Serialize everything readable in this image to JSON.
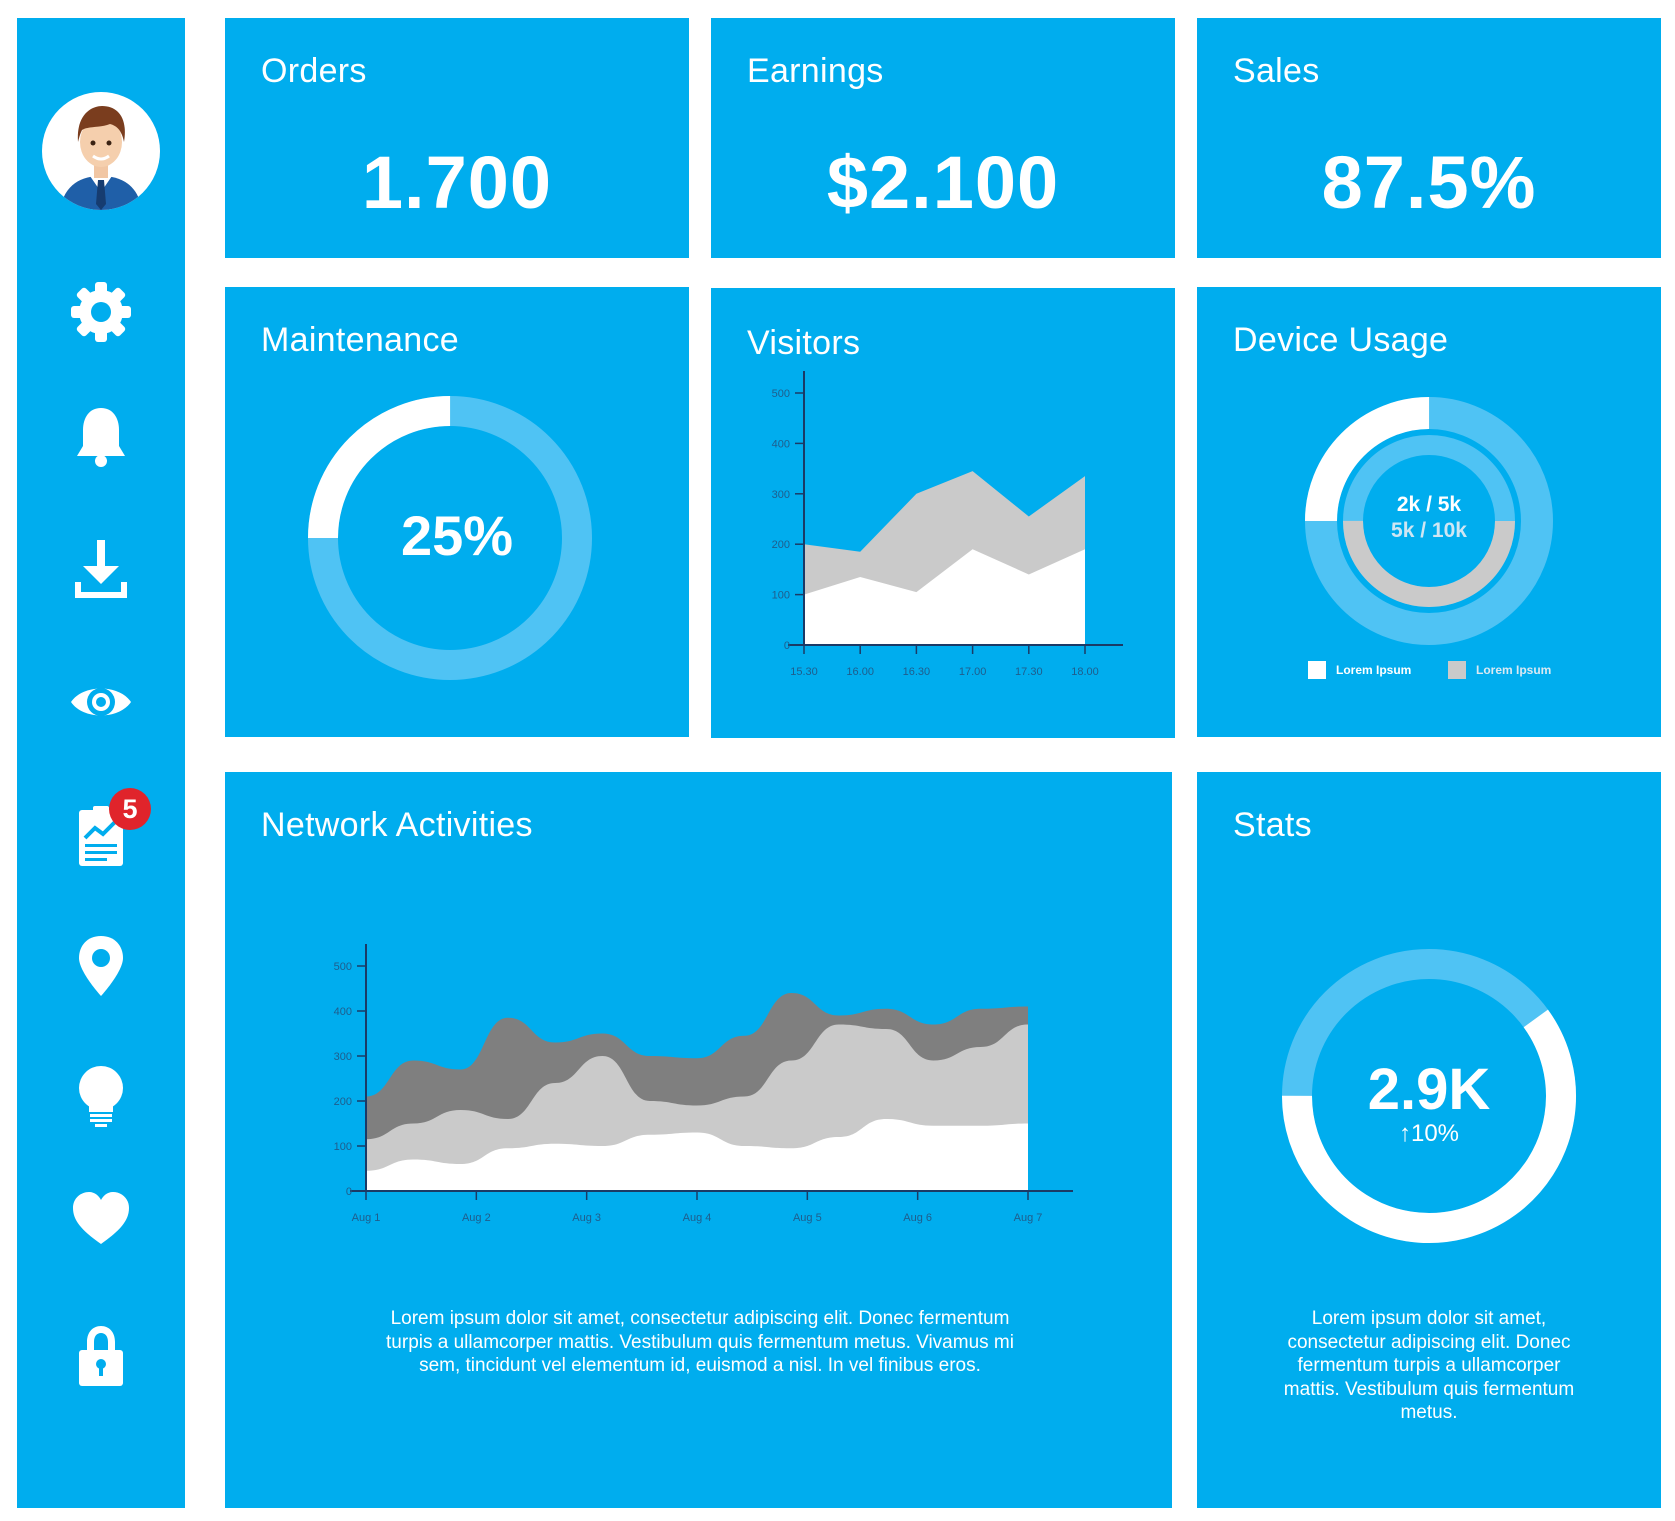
{
  "colors": {
    "panel": "#00adee",
    "ring_light": "#4fc3f4",
    "white": "#ffffff",
    "gray_light": "#cacaca",
    "gray_dark": "#7f7f7f",
    "axis": "#1b3a66",
    "badge": "#e0242b"
  },
  "sidebar": {
    "icons": [
      "gear-icon",
      "bell-icon",
      "download-icon",
      "eye-icon",
      "report-icon",
      "location-pin-icon",
      "lightbulb-icon",
      "heart-icon",
      "lock-icon"
    ],
    "badge_count": "5"
  },
  "orders": {
    "title": "Orders",
    "value": "1.700"
  },
  "earnings": {
    "title": "Earnings",
    "value": "$2.100"
  },
  "sales": {
    "title": "Sales",
    "value": "87.5%"
  },
  "maintenance": {
    "title": "Maintenance",
    "value": "25%",
    "fraction": 0.25
  },
  "visitors": {
    "title": "Visitors",
    "chart_data": {
      "type": "area",
      "x": [
        "15.30",
        "16.00",
        "16.30",
        "17.00",
        "17.30",
        "18.00"
      ],
      "series": [
        {
          "color": "#cacaca",
          "values": [
            200,
            185,
            300,
            345,
            255,
            335
          ]
        },
        {
          "color": "#ffffff",
          "values": [
            100,
            135,
            105,
            190,
            140,
            190
          ]
        }
      ],
      "y_ticks": [
        "0",
        "100",
        "200",
        "300",
        "400",
        "500"
      ],
      "ylim": [
        0,
        500
      ]
    }
  },
  "device_usage": {
    "title": "Device Usage",
    "outer_fraction": 0.25,
    "inner_fraction": 0.5,
    "line1": "2k / 5k",
    "line2": "5k / 10k",
    "legend": [
      {
        "label": "Lorem Ipsum",
        "color": "#ffffff"
      },
      {
        "label": "Lorem Ipsum",
        "color": "#cacaca"
      }
    ]
  },
  "network": {
    "title": "Network Activities",
    "chart_data": {
      "type": "area",
      "x": [
        "Aug 1",
        "Aug 2",
        "Aug 3",
        "Aug 4",
        "Aug 5",
        "Aug 6",
        "Aug 7"
      ],
      "y_ticks": [
        "0",
        "100",
        "200",
        "300",
        "400",
        "500"
      ],
      "ylim": [
        0,
        500
      ],
      "series": [
        {
          "color": "#7f7f7f",
          "values": [
            210,
            290,
            270,
            385,
            330,
            350,
            300,
            295,
            345,
            440,
            390,
            405,
            370,
            405,
            410
          ]
        },
        {
          "color": "#cacaca",
          "values": [
            115,
            150,
            180,
            160,
            240,
            300,
            200,
            190,
            210,
            290,
            370,
            360,
            290,
            320,
            370
          ]
        },
        {
          "color": "#ffffff",
          "values": [
            45,
            70,
            60,
            95,
            105,
            100,
            125,
            130,
            100,
            95,
            120,
            160,
            145,
            145,
            150
          ]
        }
      ]
    },
    "text": "Lorem ipsum dolor sit amet, consectetur adipiscing elit. Donec fermentum turpis a ullamcorper mattis. Vestibulum quis fermentum metus. Vivamus mi sem, tincidunt vel elementum id, euismod a nisl. In vel finibus eros."
  },
  "stats": {
    "title": "Stats",
    "value": "2.9K",
    "change": "↑10%",
    "fraction": 0.6,
    "text": "Lorem ipsum dolor sit amet, consectetur adipiscing elit. Donec fermentum turpis a ullamcorper mattis. Vestibulum quis fermentum metus."
  }
}
